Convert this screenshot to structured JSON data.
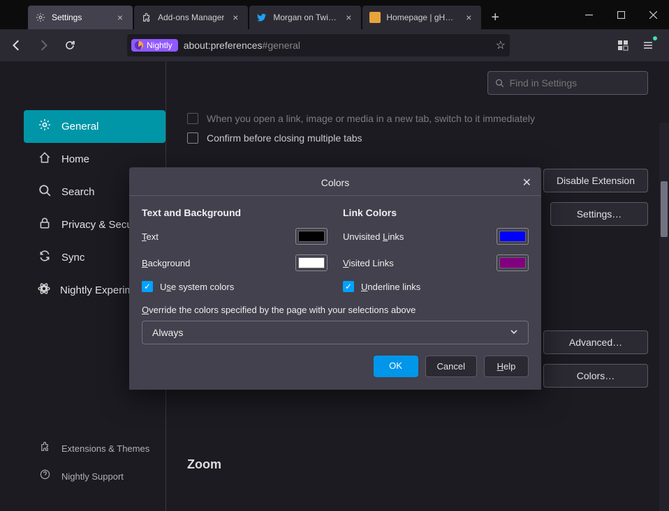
{
  "tabs": [
    {
      "title": "Settings",
      "icon": "gear"
    },
    {
      "title": "Add-ons Manager",
      "icon": "puzzle"
    },
    {
      "title": "Morgan on Twitter: \"P",
      "icon": "twitter"
    },
    {
      "title": "Homepage | gHacks T",
      "icon": "ghacks"
    }
  ],
  "url": {
    "badge": "Nightly",
    "path": "about:preferences",
    "hash": "#general"
  },
  "search": {
    "placeholder": "Find in Settings"
  },
  "sidebar": {
    "items": [
      {
        "label": "General"
      },
      {
        "label": "Home"
      },
      {
        "label": "Search"
      },
      {
        "label": "Privacy & Security"
      },
      {
        "label": "Sync"
      },
      {
        "label": "Nightly Experiments"
      }
    ],
    "bottom": [
      {
        "label": "Extensions & Themes"
      },
      {
        "label": "Nightly Support"
      }
    ]
  },
  "prefs": {
    "switch_tab": "When you open a link, image or media in a new tab, switch to it immediately",
    "confirm_close": "Confirm before closing multiple tabs"
  },
  "buttons": {
    "disable_ext": "Disable Extension",
    "settings": "Settings…",
    "advanced": "Advanced…",
    "colors": "Colors…"
  },
  "zoom_heading": "Zoom",
  "dialog": {
    "title": "Colors",
    "text_bg_heading": "Text and Background",
    "link_heading": "Link Colors",
    "text_label": "Text",
    "background_label": "Background",
    "unvisited_label": "Unvisited Links",
    "visited_label": "Visited Links",
    "use_system": "Use system colors",
    "underline": "Underline links",
    "override_label": "Override the colors specified by the page with your selections above",
    "override_value": "Always",
    "ok": "OK",
    "cancel": "Cancel",
    "help": "Help",
    "colors": {
      "text": "#000000",
      "background": "#ffffff",
      "unvisited": "#0000ff",
      "visited": "#800080"
    }
  }
}
